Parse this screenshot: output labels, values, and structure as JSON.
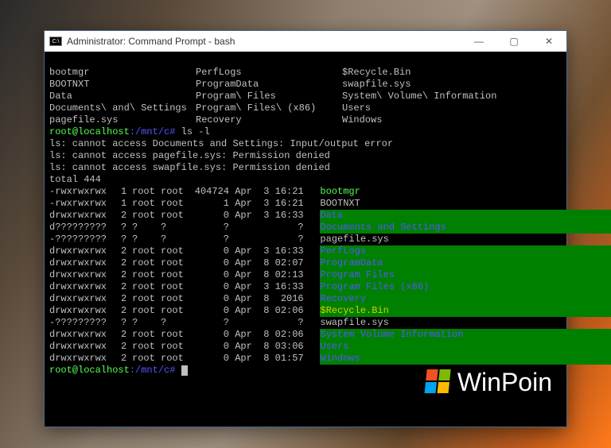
{
  "window": {
    "title": "Administrator: Command Prompt - bash",
    "icon_label": "C:\\",
    "controls": {
      "min": "—",
      "max": "▢",
      "close": "✕"
    }
  },
  "columns": [
    [
      "bootmgr",
      "PerfLogs",
      "$Recycle.Bin"
    ],
    [
      "BOOTNXT",
      "ProgramData",
      "swapfile.sys"
    ],
    [
      "Data",
      "Program\\ Files",
      "System\\ Volume\\ Information"
    ],
    [
      "Documents\\ and\\ Settings",
      "Program\\ Files\\ (x86)",
      "Users"
    ],
    [
      "pagefile.sys",
      "Recovery",
      "Windows"
    ]
  ],
  "prompt1": {
    "user": "root@localhost",
    "path": ":/mnt/c#",
    "cmd": " ls -l"
  },
  "errors": [
    "ls: cannot access Documents and Settings: Input/output error",
    "ls: cannot access pagefile.sys: Permission denied",
    "ls: cannot access swapfile.sys: Permission denied"
  ],
  "total": "total 444",
  "listing": [
    {
      "perm": "-rwxrwxrwx",
      "l": "1",
      "o": "root",
      "g": "root",
      "sz": "404724",
      "dt": "Apr  3 16:21",
      "name": "bootmgr",
      "cls": "g"
    },
    {
      "perm": "-rwxrwxrwx",
      "l": "1",
      "o": "root",
      "g": "root",
      "sz": "1",
      "dt": "Apr  3 16:21",
      "name": "BOOTNXT",
      "cls": ""
    },
    {
      "perm": "drwxrwxrwx",
      "l": "2",
      "o": "root",
      "g": "root",
      "sz": "0",
      "dt": "Apr  3 16:33",
      "name": "Data",
      "cls": "hg"
    },
    {
      "perm": "d?????????",
      "l": "?",
      "o": "?",
      "g": "?",
      "sz": "?",
      "dt": "           ?",
      "name": "Documents and Settings",
      "cls": "hg"
    },
    {
      "perm": "-?????????",
      "l": "?",
      "o": "?",
      "g": "?",
      "sz": "?",
      "dt": "           ?",
      "name": "pagefile.sys",
      "cls": ""
    },
    {
      "perm": "drwxrwxrwx",
      "l": "2",
      "o": "root",
      "g": "root",
      "sz": "0",
      "dt": "Apr  3 16:33",
      "name": "PerfLogs",
      "cls": "hg"
    },
    {
      "perm": "drwxrwxrwx",
      "l": "2",
      "o": "root",
      "g": "root",
      "sz": "0",
      "dt": "Apr  8 02:07",
      "name": "ProgramData",
      "cls": "hg"
    },
    {
      "perm": "drwxrwxrwx",
      "l": "2",
      "o": "root",
      "g": "root",
      "sz": "0",
      "dt": "Apr  8 02:13",
      "name": "Program Files",
      "cls": "hg"
    },
    {
      "perm": "drwxrwxrwx",
      "l": "2",
      "o": "root",
      "g": "root",
      "sz": "0",
      "dt": "Apr  3 16:33",
      "name": "Program Files (x86)",
      "cls": "hg"
    },
    {
      "perm": "drwxrwxrwx",
      "l": "2",
      "o": "root",
      "g": "root",
      "sz": "0",
      "dt": "Apr  8  2016",
      "name": "Recovery",
      "cls": "hg"
    },
    {
      "perm": "drwxrwxrwx",
      "l": "2",
      "o": "root",
      "g": "root",
      "sz": "0",
      "dt": "Apr  8 02:06",
      "name": "$Recycle.Bin",
      "cls": "hy"
    },
    {
      "perm": "-?????????",
      "l": "?",
      "o": "?",
      "g": "?",
      "sz": "?",
      "dt": "           ?",
      "name": "swapfile.sys",
      "cls": ""
    },
    {
      "perm": "drwxrwxrwx",
      "l": "2",
      "o": "root",
      "g": "root",
      "sz": "0",
      "dt": "Apr  8 02:06",
      "name": "System Volume Information",
      "cls": "hg"
    },
    {
      "perm": "drwxrwxrwx",
      "l": "2",
      "o": "root",
      "g": "root",
      "sz": "0",
      "dt": "Apr  8 03:06",
      "name": "Users",
      "cls": "hg"
    },
    {
      "perm": "drwxrwxrwx",
      "l": "2",
      "o": "root",
      "g": "root",
      "sz": "0",
      "dt": "Apr  8 01:57",
      "name": "Windows",
      "cls": "hg"
    }
  ],
  "prompt2": {
    "user": "root@localhost",
    "path": ":/mnt/c#",
    "cmd": " "
  },
  "watermark": "WinPoin"
}
